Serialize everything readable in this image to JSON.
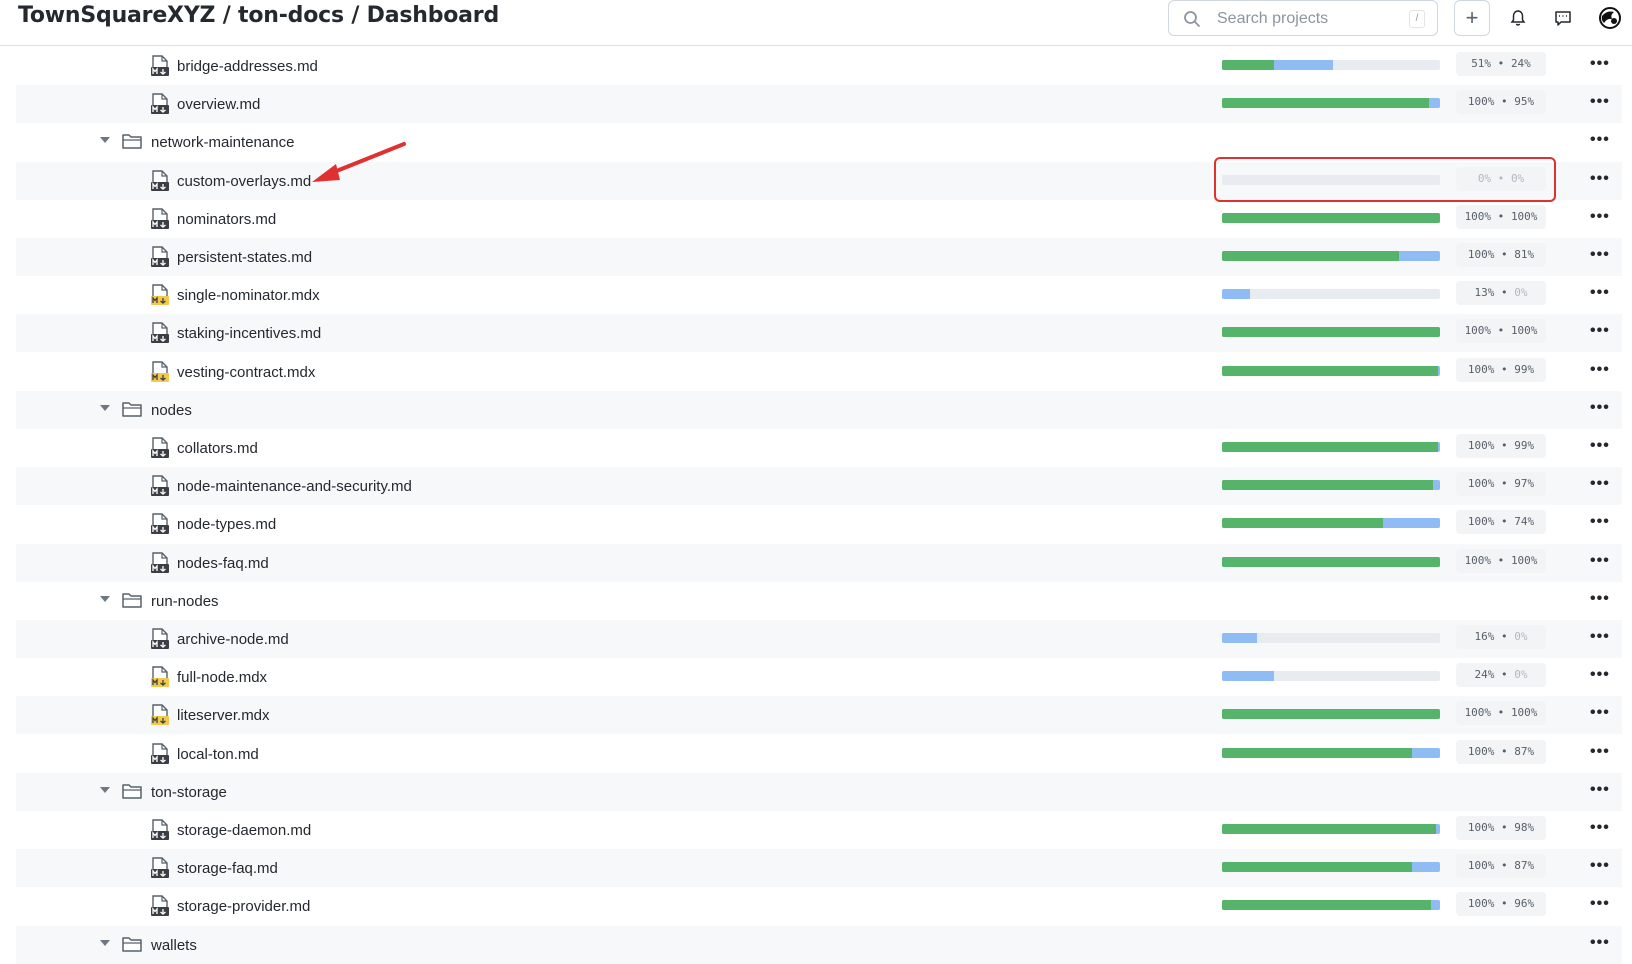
{
  "header": {
    "title": "TownSquareXYZ / ton-docs / Dashboard",
    "search_placeholder": "Search projects",
    "search_shortcut": "/",
    "buttons": [
      "plus-icon",
      "bell-icon",
      "comment-icon",
      "avatar"
    ]
  },
  "colors": {
    "translated": "#56b36a",
    "approved": "#8fbcf5",
    "empty": "#e8ebef",
    "highlight": "#e03131"
  },
  "rows": [
    {
      "type": "file",
      "name": "bridge-addresses.md",
      "icon": "md",
      "translated": 51,
      "approved": 24,
      "label_a": "51%",
      "label_b": "24%"
    },
    {
      "type": "file",
      "name": "overview.md",
      "icon": "md",
      "translated": 100,
      "approved": 95,
      "label_a": "100%",
      "label_b": "95%"
    },
    {
      "type": "folder",
      "name": "network-maintenance"
    },
    {
      "type": "file",
      "name": "custom-overlays.md",
      "icon": "md",
      "translated": 0,
      "approved": 0,
      "label_a": "0%",
      "label_b": "0%",
      "highlighted": true
    },
    {
      "type": "file",
      "name": "nominators.md",
      "icon": "md",
      "translated": 100,
      "approved": 100,
      "label_a": "100%",
      "label_b": "100%"
    },
    {
      "type": "file",
      "name": "persistent-states.md",
      "icon": "md",
      "translated": 100,
      "approved": 81,
      "label_a": "100%",
      "label_b": "81%"
    },
    {
      "type": "file",
      "name": "single-nominator.mdx",
      "icon": "mdx",
      "translated": 13,
      "approved": 0,
      "label_a": "13%",
      "label_b": "0%"
    },
    {
      "type": "file",
      "name": "staking-incentives.md",
      "icon": "md",
      "translated": 100,
      "approved": 100,
      "label_a": "100%",
      "label_b": "100%"
    },
    {
      "type": "file",
      "name": "vesting-contract.mdx",
      "icon": "mdx",
      "translated": 100,
      "approved": 99,
      "label_a": "100%",
      "label_b": "99%"
    },
    {
      "type": "folder",
      "name": "nodes"
    },
    {
      "type": "file",
      "name": "collators.md",
      "icon": "md",
      "translated": 100,
      "approved": 99,
      "label_a": "100%",
      "label_b": "99%"
    },
    {
      "type": "file",
      "name": "node-maintenance-and-security.md",
      "icon": "md",
      "translated": 100,
      "approved": 97,
      "label_a": "100%",
      "label_b": "97%"
    },
    {
      "type": "file",
      "name": "node-types.md",
      "icon": "md",
      "translated": 100,
      "approved": 74,
      "label_a": "100%",
      "label_b": "74%"
    },
    {
      "type": "file",
      "name": "nodes-faq.md",
      "icon": "md",
      "translated": 100,
      "approved": 100,
      "label_a": "100%",
      "label_b": "100%"
    },
    {
      "type": "folder",
      "name": "run-nodes"
    },
    {
      "type": "file",
      "name": "archive-node.md",
      "icon": "md",
      "translated": 16,
      "approved": 0,
      "label_a": "16%",
      "label_b": "0%"
    },
    {
      "type": "file",
      "name": "full-node.mdx",
      "icon": "mdx",
      "translated": 24,
      "approved": 0,
      "label_a": "24%",
      "label_b": "0%"
    },
    {
      "type": "file",
      "name": "liteserver.mdx",
      "icon": "mdx",
      "translated": 100,
      "approved": 100,
      "label_a": "100%",
      "label_b": "100%"
    },
    {
      "type": "file",
      "name": "local-ton.md",
      "icon": "md",
      "translated": 100,
      "approved": 87,
      "label_a": "100%",
      "label_b": "87%"
    },
    {
      "type": "folder",
      "name": "ton-storage"
    },
    {
      "type": "file",
      "name": "storage-daemon.md",
      "icon": "md",
      "translated": 100,
      "approved": 98,
      "label_a": "100%",
      "label_b": "98%"
    },
    {
      "type": "file",
      "name": "storage-faq.md",
      "icon": "md",
      "translated": 100,
      "approved": 87,
      "label_a": "100%",
      "label_b": "87%"
    },
    {
      "type": "file",
      "name": "storage-provider.md",
      "icon": "md",
      "translated": 100,
      "approved": 96,
      "label_a": "100%",
      "label_b": "96%"
    },
    {
      "type": "folder",
      "name": "wallets"
    }
  ],
  "row_menu_label": "•••"
}
